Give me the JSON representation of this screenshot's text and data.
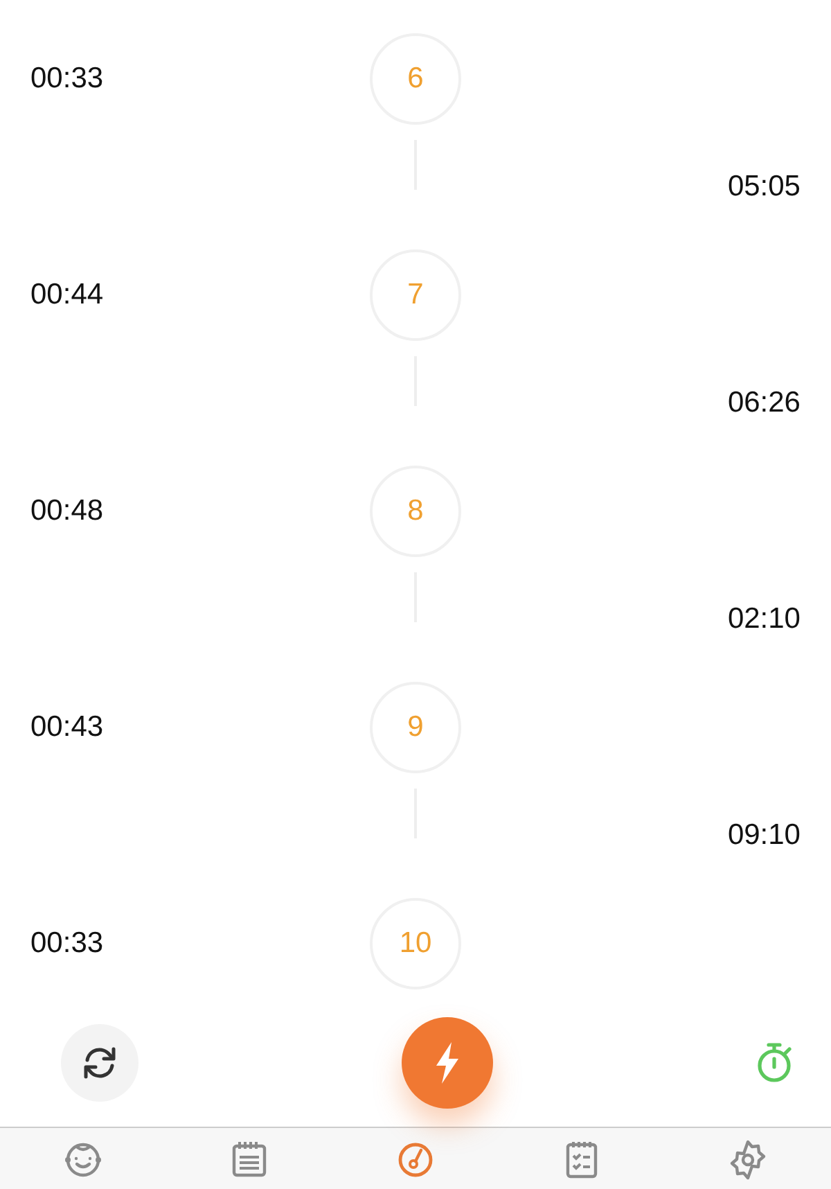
{
  "contractions": [
    {
      "number": "6",
      "duration": "00:33",
      "interval": "05:05"
    },
    {
      "number": "7",
      "duration": "00:44",
      "interval": "06:26"
    },
    {
      "number": "8",
      "duration": "00:48",
      "interval": "02:10"
    },
    {
      "number": "9",
      "duration": "00:43",
      "interval": "09:10"
    },
    {
      "number": "10",
      "duration": "00:33"
    }
  ],
  "tabs": [
    {
      "kind": "baby",
      "selected": false
    },
    {
      "kind": "calendar",
      "selected": false
    },
    {
      "kind": "gauge",
      "selected": true
    },
    {
      "kind": "checklist",
      "selected": false
    },
    {
      "kind": "settings",
      "selected": false
    }
  ]
}
